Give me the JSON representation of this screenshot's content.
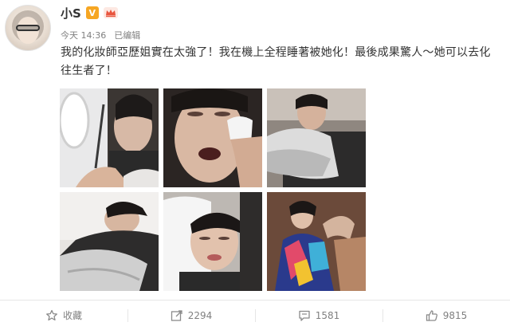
{
  "user": {
    "name": "小S",
    "verified_badge": "V",
    "vip_icon": "crown-icon"
  },
  "meta": {
    "time": "今天 14:36",
    "edited": "已编辑"
  },
  "post": {
    "text": "我的化妝師亞歷姐實在太強了！我在機上全程睡著被她化！最後成果驚人～她可以去化往生者了！"
  },
  "photos": [
    {
      "label": "photo-1"
    },
    {
      "label": "photo-2"
    },
    {
      "label": "photo-3"
    },
    {
      "label": "photo-4"
    },
    {
      "label": "photo-5"
    },
    {
      "label": "photo-6"
    }
  ],
  "actions": {
    "favorite": {
      "label": "收藏",
      "icon": "star-icon"
    },
    "repost": {
      "label": "2294",
      "icon": "share-icon"
    },
    "comment": {
      "label": "1581",
      "icon": "comment-icon"
    },
    "like": {
      "label": "9815",
      "icon": "thumbs-up-icon"
    }
  },
  "colors": {
    "vip_badge": "#f6a623",
    "meta_text": "#808080",
    "body_text": "#333333"
  }
}
